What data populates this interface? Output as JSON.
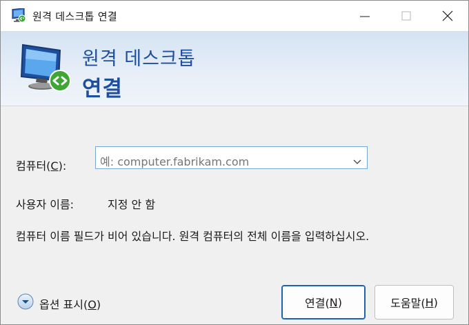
{
  "window": {
    "title": "원격 데스크톱 연결"
  },
  "banner": {
    "line1": "원격 데스크톱",
    "line2": "연결"
  },
  "form": {
    "computer_label": "컴퓨터(",
    "computer_mnemonic": "C",
    "computer_label_end": "):",
    "computer_placeholder": "예: computer.fabrikam.com",
    "username_label": "사용자 이름:",
    "username_value": "지정 안 함",
    "info_text": "컴퓨터 이름 필드가 비어 있습니다. 원격 컴퓨터의 전체 이름을 입력하십시오."
  },
  "options": {
    "label": "옵션 표시(",
    "mnemonic": "O",
    "label_end": ")"
  },
  "buttons": {
    "connect": {
      "label": "연결(",
      "mnemonic": "N",
      "label_end": ")"
    },
    "help": {
      "label": "도움말(",
      "mnemonic": "H",
      "label_end": ")"
    }
  },
  "colors": {
    "banner_text": "#1e4f9e",
    "accent_border": "#1e5fb0",
    "input_border": "#7aa6d6"
  },
  "icons": {
    "app": "remote-desktop-icon",
    "options": "expand-chevron-icon",
    "dropdown": "chevron-down-icon"
  }
}
